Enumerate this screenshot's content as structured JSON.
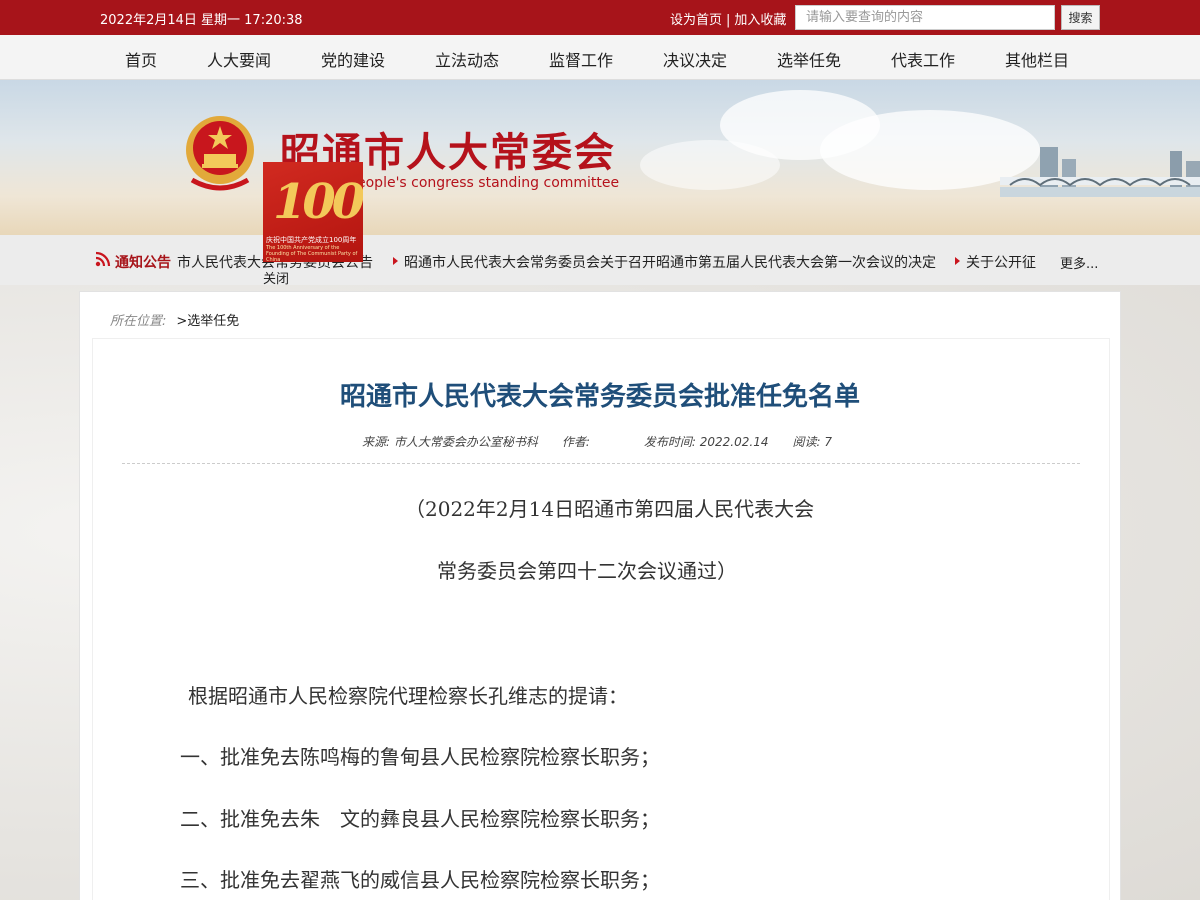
{
  "topbar": {
    "datetime": "2022年2月14日 星期一 17:20:38",
    "set_home": "设为首页",
    "separator": "|",
    "add_favorite": "加入收藏",
    "search_placeholder": "请输入要查询的内容",
    "search_button": "搜索"
  },
  "nav": {
    "items": [
      "首页",
      "人大要闻",
      "党的建设",
      "立法动态",
      "监督工作",
      "决议决定",
      "选举任免",
      "代表工作",
      "其他栏目"
    ]
  },
  "banner": {
    "title": "昭通市人大常委会",
    "subtitle": "eople's congress standing committee"
  },
  "badge": {
    "number": "100",
    "caption": "庆祝中国共产党成立100周年",
    "caption_en": "The 100th Anniversary of the Founding of The Communist Party of China",
    "close": "关闭"
  },
  "notice": {
    "label": "通知公告",
    "items": [
      "市人民代表大会常务委员会公告",
      "昭通市人民代表大会常务委员会关于召开昭通市第五届人民代表大会第一次会议的决定",
      "关于公开征"
    ],
    "more": "更多..."
  },
  "breadcrumb": {
    "label": "所在位置:",
    "current": ">选举任免"
  },
  "article": {
    "title": "昭通市人民代表大会常务委员会批准任免名单",
    "source": "来源:  市人大常委会办公室秘书科",
    "author": "作者:",
    "published": "发布时间:  2022.02.14",
    "reads": "阅读:  7",
    "paragraphs": [
      "（2022年2月14日昭通市第四届人民代表大会",
      "常务委员会第四十二次会议通过）",
      "根据昭通市人民检察院代理检察长孔维志的提请：",
      "一、批准免去陈鸣梅的鲁甸县人民检察院检察长职务；",
      "二、批准免去朱　文的彝良县人民检察院检察长职务；",
      "三、批准免去翟燕飞的威信县人民检察院检察长职务；"
    ]
  },
  "colors": {
    "brand_red": "#a7141a",
    "title_blue": "#1f4e79",
    "gold": "#f3c95a"
  }
}
